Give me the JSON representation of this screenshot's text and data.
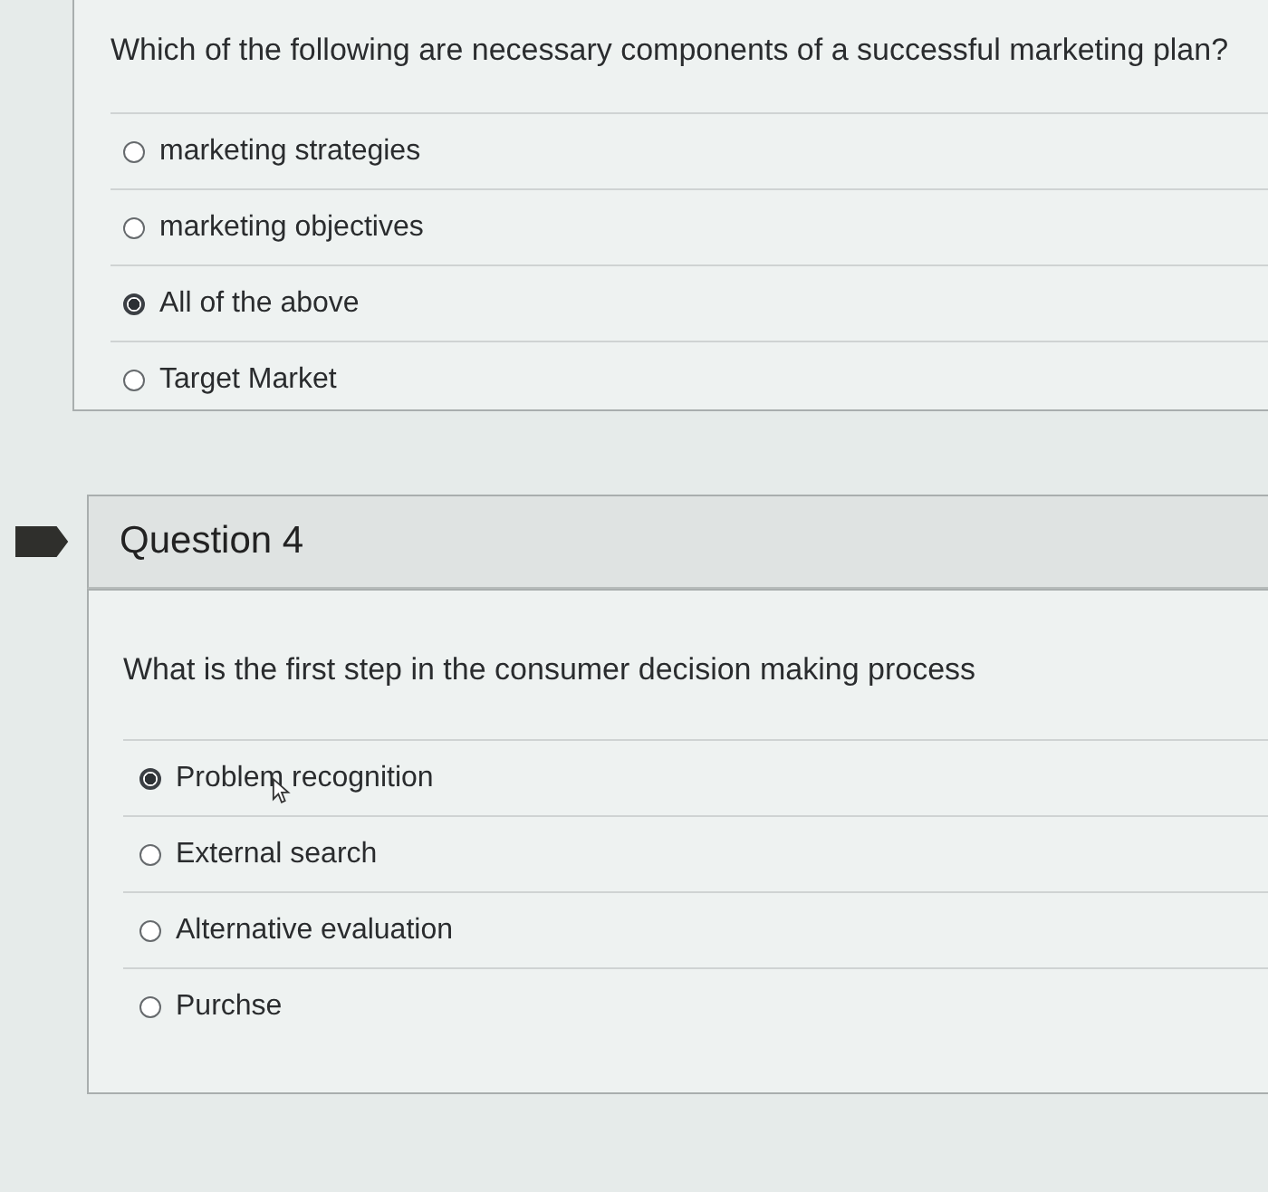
{
  "questions": [
    {
      "prompt": "Which of the following are necessary components of a successful marketing plan?",
      "options": [
        {
          "label": "marketing strategies",
          "selected": false
        },
        {
          "label": "marketing objectives",
          "selected": false
        },
        {
          "label": "All of the above",
          "selected": true
        },
        {
          "label": "Target Market",
          "selected": false
        }
      ]
    },
    {
      "header": "Question 4",
      "bookmarked": true,
      "prompt": "What is the first step in the consumer decision making process",
      "options": [
        {
          "label": "Problem recognition",
          "selected": true
        },
        {
          "label": "External search",
          "selected": false
        },
        {
          "label": "Alternative evaluation",
          "selected": false
        },
        {
          "label": "Purchse",
          "selected": false
        }
      ]
    }
  ]
}
